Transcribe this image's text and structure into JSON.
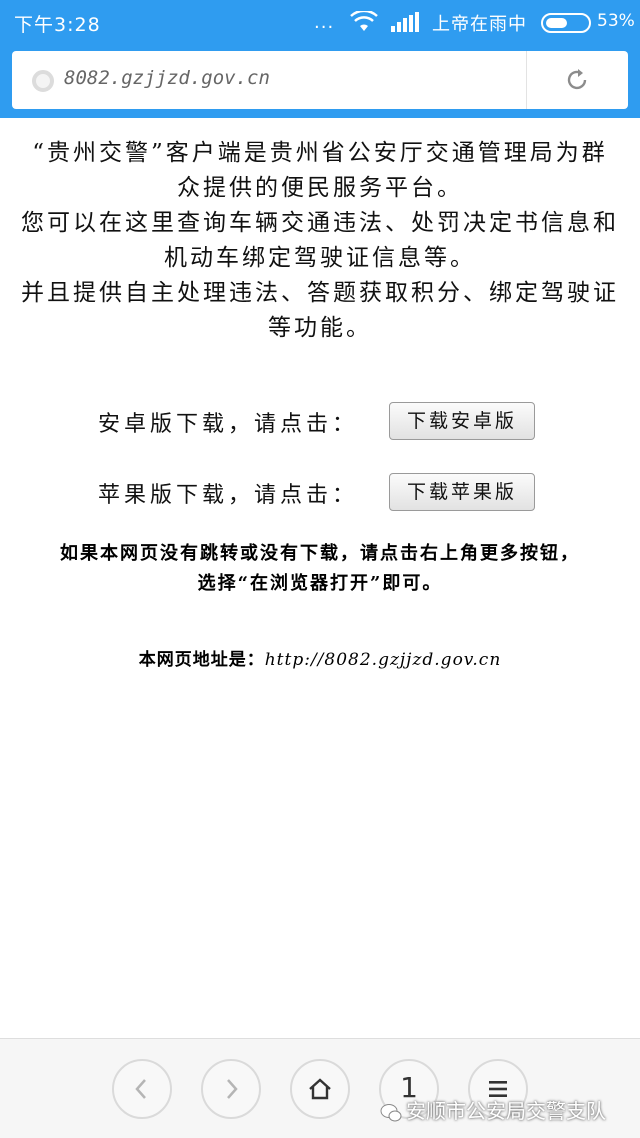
{
  "status_bar": {
    "time": "下午3:28",
    "dots": "...",
    "carrier": "上帝在雨中",
    "battery_percent": "53%",
    "battery_level": 0.53
  },
  "address_bar": {
    "url": "8082.gzjjzd.gov.cn"
  },
  "intro": {
    "line1": "“贵州交警”客户端是贵州省公安厅交通管理局为群众提供的便民服务平台。",
    "line2": "您可以在这里查询车辆交通违法、处罚决定书信息和机动车绑定驾驶证信息等。",
    "line3": "并且提供自主处理违法、答题获取积分、绑定驾驶证等功能。"
  },
  "android": {
    "label": "安卓版下载，请点击：",
    "button": "下载安卓版"
  },
  "ios": {
    "label": "苹果版下载，请点击：",
    "button": "下载苹果版"
  },
  "notice": {
    "line1": "如果本网页没有跳转或没有下载，请点击右上角更多按钮，",
    "line2": "选择“在浏览器打开”即可。"
  },
  "page_address": {
    "label": "本网页地址是：",
    "url": "http://8082.gzjjzd.gov.cn"
  },
  "bottom_bar": {
    "tab_count": "1",
    "watermark": "安顺市公安局交警支队"
  },
  "colors": {
    "status_bar_bg": "#2f9cf0",
    "page_bg": "#ffffff",
    "bottom_bar_bg": "#f6f6f6"
  }
}
